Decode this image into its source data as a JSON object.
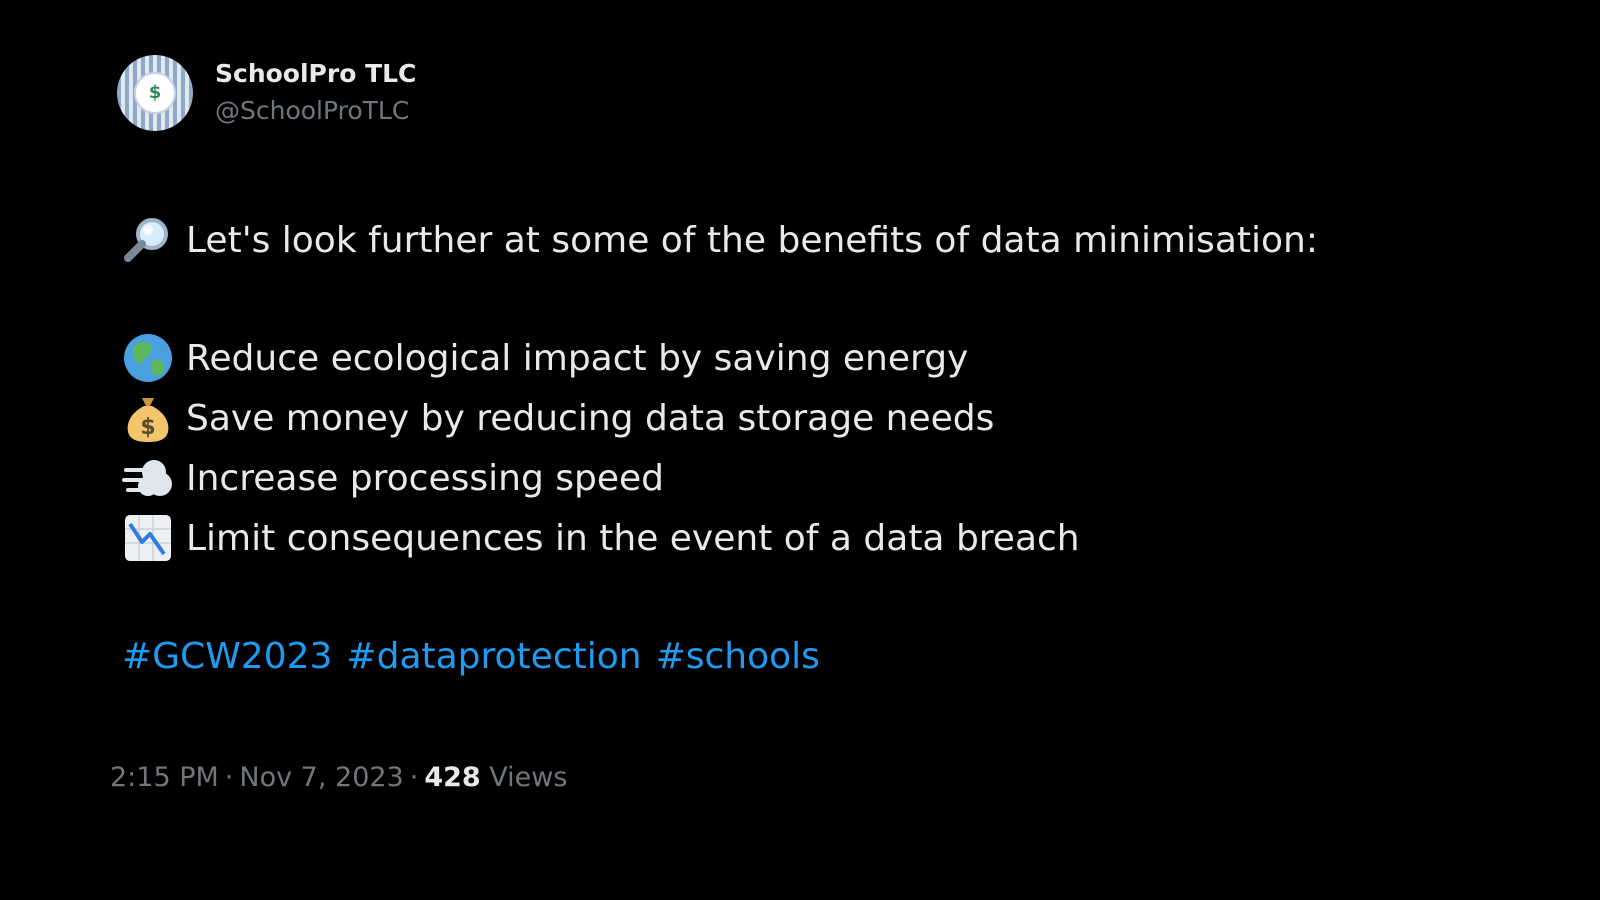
{
  "author": {
    "display_name": "SchoolPro TLC",
    "handle": "@SchoolProTLC",
    "avatar_glyph": "$",
    "avatar_icon": "schoolpro-logo-avatar"
  },
  "tweet": {
    "intro": {
      "icon": "magnifying-glass-icon",
      "text": "Let's look further at some of the benefits of data minimisation:"
    },
    "benefits": [
      {
        "icon": "globe-icon",
        "text": "Reduce ecological impact by saving energy"
      },
      {
        "icon": "money-bag-icon",
        "text": "Save money by reducing data storage needs"
      },
      {
        "icon": "dashing-away-icon",
        "text": "Increase processing speed"
      },
      {
        "icon": "chart-decreasing-icon",
        "text": "Limit consequences in the event of a data breach"
      }
    ],
    "hashtags": [
      "#GCW2023",
      "#dataprotection",
      "#schools"
    ]
  },
  "meta": {
    "time": "2:15 PM",
    "date": "Nov 7, 2023",
    "separator": "·",
    "views_count": "428",
    "views_label": "Views"
  },
  "colors": {
    "background": "#000000",
    "text": "#e7e9ea",
    "muted": "#71767b",
    "link": "#1d9bf0"
  }
}
